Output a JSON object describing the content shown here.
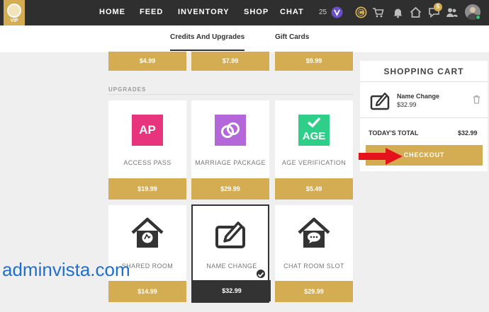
{
  "nav": {
    "logo_text": "VIP",
    "items": [
      "HOME",
      "FEED",
      "INVENTORY",
      "SHOP",
      "CHAT"
    ],
    "token_count": "25",
    "notification_count": "5"
  },
  "tabs": {
    "credits": "Credits And Upgrades",
    "gift_cards": "Gift Cards"
  },
  "top_prices": [
    "$4.99",
    "$7.99",
    "$9.99"
  ],
  "section": "UPGRADES",
  "upgrades": [
    {
      "label": "ACCESS PASS",
      "price": "$19.99",
      "tile": "AP",
      "color": "#e8347c"
    },
    {
      "label": "MARRIAGE PACKAGE",
      "price": "$29.99",
      "color": "#b467d8"
    },
    {
      "label": "AGE VERIFICATION",
      "price": "$5.49",
      "tile": "AGE",
      "color": "#2fcf8a"
    },
    {
      "label": "SHARED ROOM",
      "price": "$14.99"
    },
    {
      "label": "NAME CHANGE",
      "price": "$32.99"
    },
    {
      "label": "CHAT ROOM SLOT",
      "price": "$29.99"
    }
  ],
  "cart": {
    "title": "SHOPPING CART",
    "item_name": "Name Change",
    "item_price": "$32.99",
    "total_label": "TODAY'S TOTAL",
    "total_value": "$32.99",
    "checkout": "CHECKOUT"
  },
  "watermark": "adminvista.com",
  "colors": {
    "gold": "#d4ad52",
    "dark": "#333333",
    "arrow": "#e3121b"
  }
}
